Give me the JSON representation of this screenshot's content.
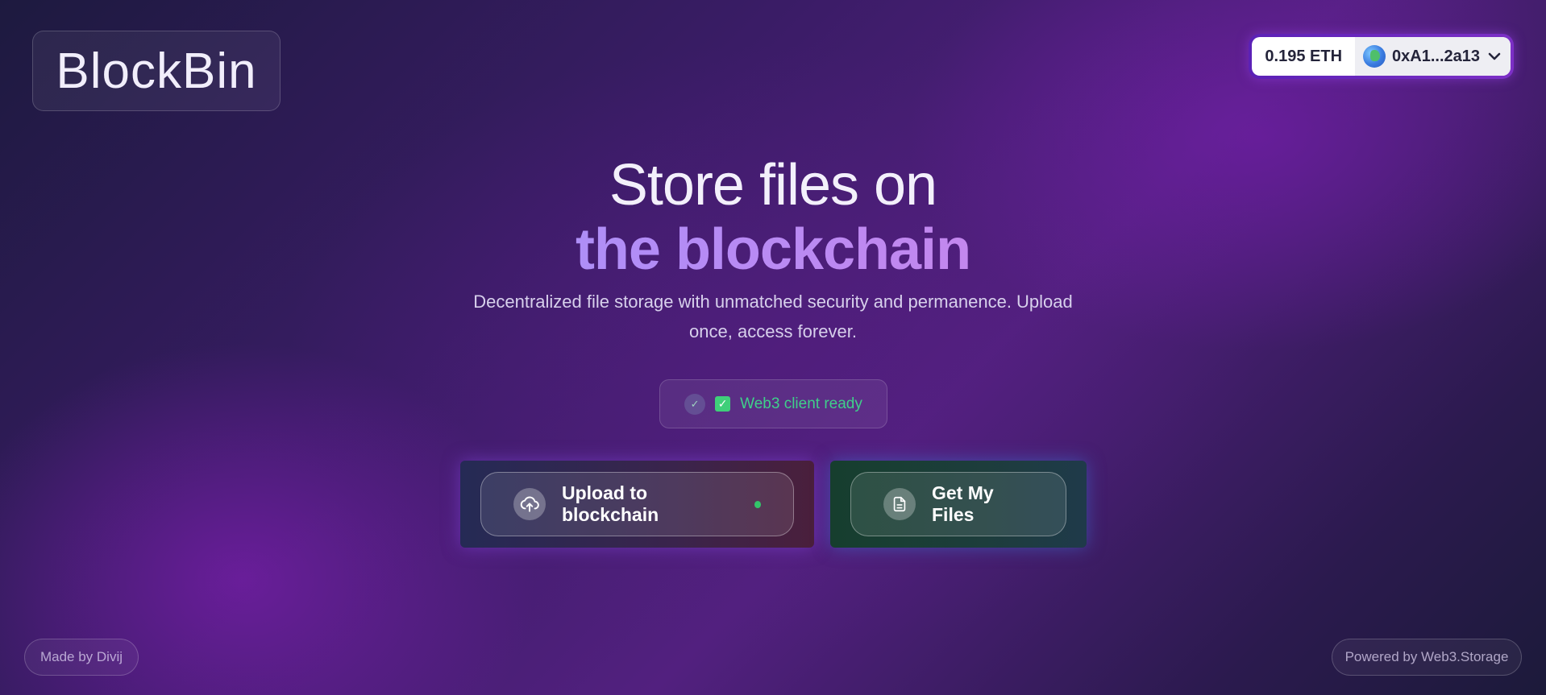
{
  "app": {
    "logo_text": "BlockBin"
  },
  "wallet": {
    "balance": "0.195 ETH",
    "account": "0xA1...2a13",
    "avatar_icon": "globe-avatar-icon",
    "dropdown_icon": "chevron-down-icon"
  },
  "hero": {
    "line1": "Store files on",
    "line2": "the blockchain",
    "subtitle": "Decentralized file storage with unmatched security and permanence. Upload once, access forever."
  },
  "status": {
    "label": "Web3 client ready",
    "color": "#3fd08a"
  },
  "actions": {
    "upload_label": "Upload to blockchain",
    "upload_icon": "cloud-upload-icon",
    "files_label": "Get My Files",
    "files_icon": "document-icon"
  },
  "footer": {
    "credit": "Made by Divij",
    "powered_by": "Powered by Web3.Storage"
  },
  "colors": {
    "gradient_start": "#8ea0ff",
    "gradient_end": "#e27fe0",
    "ready_dot": "#33c46a"
  }
}
